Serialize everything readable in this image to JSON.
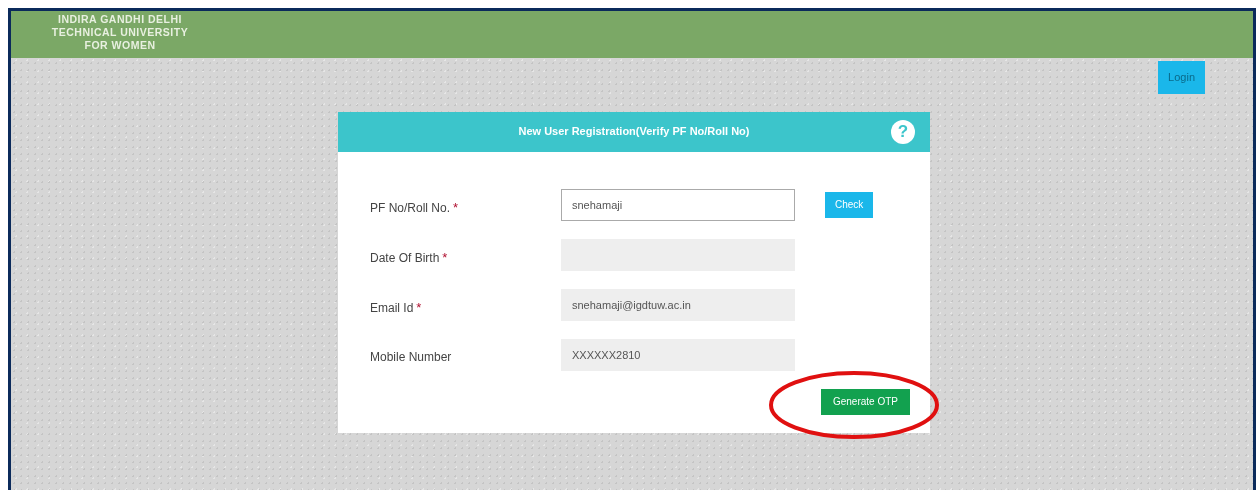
{
  "header": {
    "logo_lines": [
      "INDIRA GANDHI DELHI",
      "TECHNICAL UNIVERSITY",
      "FOR WOMEN"
    ]
  },
  "login_button": "Login",
  "card": {
    "title": "New User Registration(Verify PF No/Roll No)",
    "help_icon": "?",
    "fields": [
      {
        "label": "PF No/Roll No.",
        "required_mark": "*",
        "value": "snehamaji",
        "disabled": false,
        "action": "Check"
      },
      {
        "label": "Date Of Birth",
        "required_mark": "*",
        "disabled": true
      },
      {
        "label": "Email Id",
        "required_mark": "*",
        "value": "snehamaji@igdtuw.ac.in",
        "disabled": true
      },
      {
        "label": "Mobile Number",
        "value": "XXXXXX2810",
        "disabled": true
      }
    ],
    "submit": {
      "label": "Generate OTP",
      "highlighted": true
    }
  }
}
